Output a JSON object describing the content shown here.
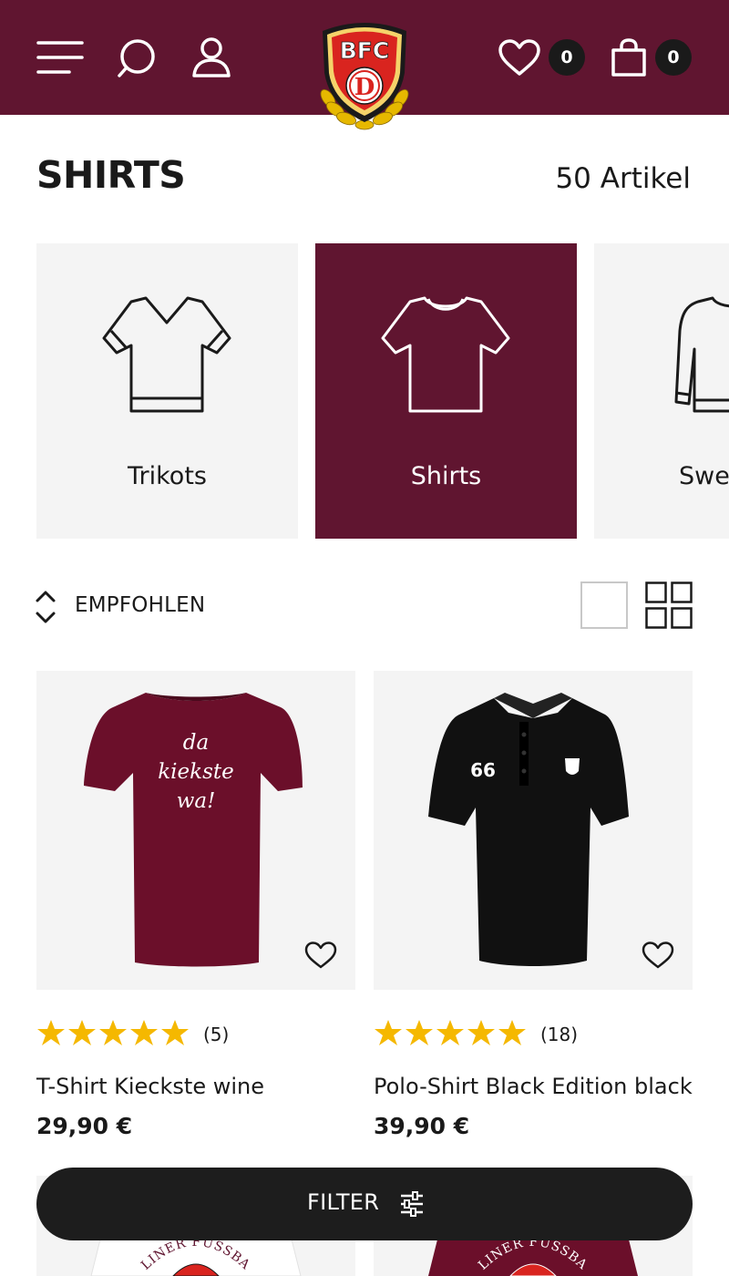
{
  "header": {
    "brand": "BFC",
    "brand_letter": "D",
    "wishlist_count": "0",
    "cart_count": "0",
    "icons": [
      "menu-icon",
      "search-icon",
      "user-icon",
      "heart-icon",
      "bag-icon"
    ],
    "colors": {
      "primary": "#601530",
      "badge": "#1a1a1a"
    }
  },
  "page": {
    "title": "SHIRTS",
    "count_label": "50 Artikel"
  },
  "categories": [
    {
      "label": "Trikots",
      "icon": "jersey-icon",
      "active": false
    },
    {
      "label": "Shirts",
      "icon": "tshirt-icon",
      "active": true
    },
    {
      "label": "Swea",
      "icon": "sweater-icon",
      "active": false
    }
  ],
  "sort": {
    "label": "EMPFOHLEN",
    "icon": "sort-icon"
  },
  "view_modes": [
    "single-view-icon",
    "grid-view-icon"
  ],
  "products": [
    {
      "name": "T-Shirt Kieckste wine",
      "price": "29,90 €",
      "rating": 5,
      "review_count": "(5)",
      "shirt_text": [
        "da",
        "kiekste",
        "wa!"
      ],
      "shirt_color": "#6b0f2a"
    },
    {
      "name": "Polo-Shirt Black Edition black",
      "price": "39,90 €",
      "rating": 5,
      "review_count": "(18)",
      "shirt_number": "66",
      "shirt_color": "#111111"
    }
  ],
  "peek_products": [
    {
      "shirt_text": "LINER FUSSBALLC",
      "shirt_color": "#ffffff"
    },
    {
      "shirt_text": "LINER FUSSBALLC",
      "shirt_color": "#6b0f2a"
    }
  ],
  "filter": {
    "label": "FILTER",
    "icon": "sliders-icon"
  },
  "colors": {
    "star": "#f5b800",
    "tile_bg": "#f4f4f4",
    "active_tile_bg": "#601530"
  }
}
